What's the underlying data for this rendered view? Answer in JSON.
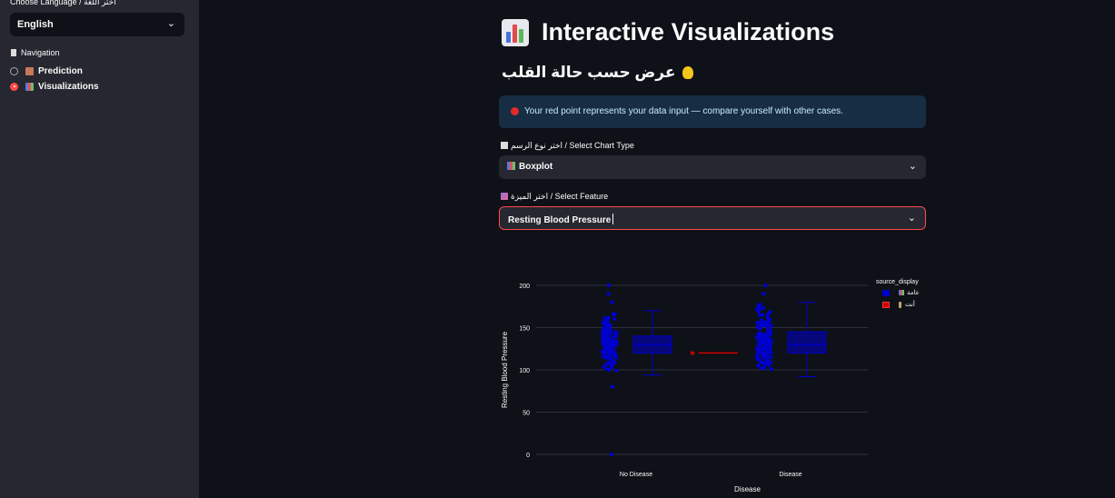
{
  "sidebar": {
    "language_label": "Choose Language / اختر اللغة",
    "language_value": "English",
    "nav_label": "Navigation",
    "nav_items": [
      {
        "label": "Prediction",
        "selected": false,
        "icon": "house-icon"
      },
      {
        "label": "Visualizations",
        "selected": true,
        "icon": "bar-chart-icon"
      }
    ]
  },
  "main": {
    "title": "Interactive Visualizations",
    "subtitle": "عرض حسب حالة القلب",
    "info": "Your red point represents your data input — compare yourself with other cases.",
    "chart_type_label": "اختر نوع الرسم / Select Chart Type",
    "chart_type_value": "Boxplot",
    "feature_label": "اختر الميزة / Select Feature",
    "feature_value": "Resting Blood Pressure"
  },
  "colors": {
    "accent": "#ff4b4b",
    "general_series": "#0000cc",
    "user_series": "#cc0000"
  },
  "chart_data": {
    "type": "box",
    "xlabel": "Disease",
    "ylabel": "Resting Blood Pressure",
    "categories": [
      "No Disease",
      "Disease"
    ],
    "yticks": [
      0,
      50,
      100,
      150,
      200
    ],
    "ylim": [
      0,
      200
    ],
    "legend_title": "source_display",
    "legend_placement": "top-right",
    "series": [
      {
        "name": "عامة",
        "color": "#0000cc",
        "boxes": [
          {
            "category": "No Disease",
            "min": 94,
            "q1": 120,
            "median": 130,
            "q3": 140,
            "max": 170,
            "outliers": [
              80,
              0,
              180,
              190,
              200
            ]
          },
          {
            "category": "Disease",
            "min": 92,
            "q1": 120,
            "median": 130,
            "q3": 145,
            "max": 180,
            "outliers": [
              190,
              200
            ]
          }
        ]
      },
      {
        "name": "أنت",
        "color": "#cc0000",
        "points": [
          {
            "category": "No Disease",
            "y": 120
          }
        ]
      }
    ]
  }
}
